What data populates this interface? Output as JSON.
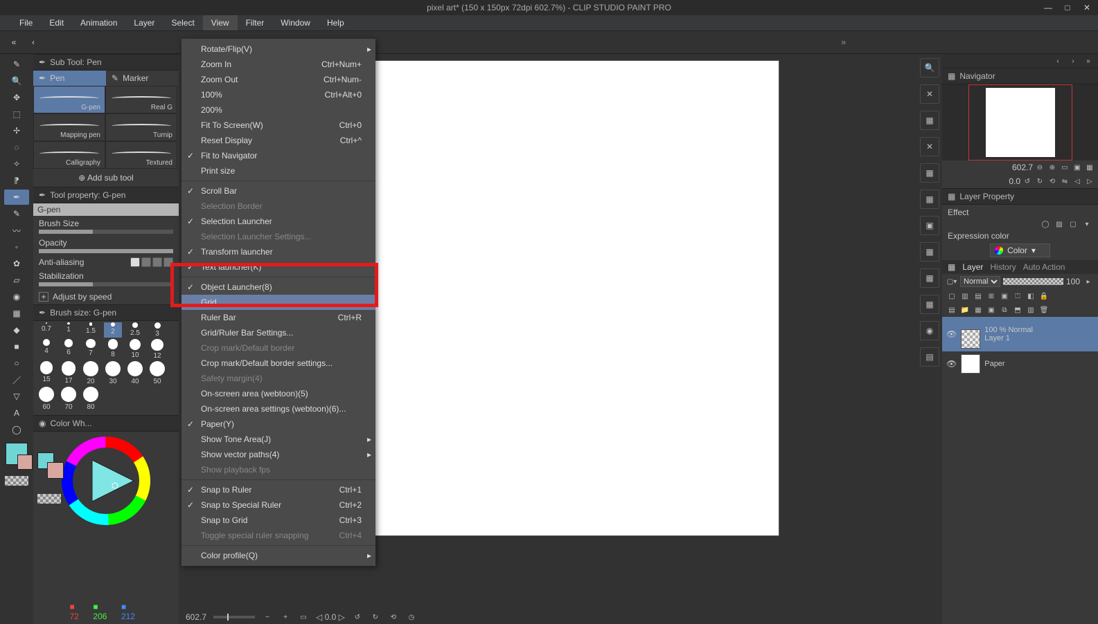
{
  "title": "pixel art* (150 x 150px 72dpi 602.7%)  -  CLIP STUDIO PAINT PRO",
  "menubar": [
    "File",
    "Edit",
    "Animation",
    "Layer",
    "Select",
    "View",
    "Filter",
    "Window",
    "Help"
  ],
  "active_menu_index": 5,
  "view_menu": [
    {
      "label": "Rotate/Flip(V)",
      "sub": true
    },
    {
      "label": "Zoom In",
      "shortcut": "Ctrl+Num+"
    },
    {
      "label": "Zoom Out",
      "shortcut": "Ctrl+Num-"
    },
    {
      "label": "100%",
      "shortcut": "Ctrl+Alt+0"
    },
    {
      "label": "200%"
    },
    {
      "label": "Fit To Screen(W)",
      "shortcut": "Ctrl+0"
    },
    {
      "label": "Reset Display",
      "shortcut": "Ctrl+^"
    },
    {
      "label": "Fit to Navigator",
      "checked": true
    },
    {
      "label": "Print size"
    },
    {
      "sep": true
    },
    {
      "label": "Scroll Bar",
      "checked": true
    },
    {
      "label": "Selection Border",
      "disabled": true
    },
    {
      "label": "Selection Launcher",
      "checked": true
    },
    {
      "label": "Selection Launcher Settings...",
      "disabled": true
    },
    {
      "label": "Transform launcher",
      "checked": true
    },
    {
      "label": "Text launcher(K)",
      "checked": true
    },
    {
      "sep": true
    },
    {
      "label": "Object Launcher(8)",
      "checked": true,
      "hidden_behind": true
    },
    {
      "label": "Grid",
      "highlighted": true
    },
    {
      "label": "Ruler Bar",
      "shortcut": "Ctrl+R"
    },
    {
      "label": "Grid/Ruler Bar Settings..."
    },
    {
      "label": "Crop mark/Default border",
      "disabled": true
    },
    {
      "label": "Crop mark/Default border settings..."
    },
    {
      "label": "Safety margin(4)",
      "disabled": true
    },
    {
      "label": "On-screen area (webtoon)(5)"
    },
    {
      "label": "On-screen area settings (webtoon)(6)..."
    },
    {
      "label": "Paper(Y)",
      "checked": true
    },
    {
      "label": "Show Tone Area(J)",
      "sub": true
    },
    {
      "label": "Show vector paths(4)",
      "sub": true
    },
    {
      "label": "Show playback fps",
      "disabled": true
    },
    {
      "sep": true
    },
    {
      "label": "Snap to Ruler",
      "checked": true,
      "shortcut": "Ctrl+1"
    },
    {
      "label": "Snap to Special Ruler",
      "checked": true,
      "shortcut": "Ctrl+2"
    },
    {
      "label": "Snap to Grid",
      "shortcut": "Ctrl+3"
    },
    {
      "label": "Toggle special ruler snapping",
      "shortcut": "Ctrl+4",
      "disabled": true
    },
    {
      "sep": true
    },
    {
      "label": "Color profile(Q)",
      "sub": true
    }
  ],
  "subtool": {
    "header": "Sub Tool: Pen",
    "tabs": [
      "Pen",
      "Marker"
    ],
    "items": [
      "G-pen",
      "Real G",
      "Mapping pen",
      "Turnip",
      "Calligraphy",
      "Textured"
    ],
    "selected": 0,
    "add": "Add sub tool"
  },
  "toolprop": {
    "header": "Tool property: G-pen",
    "name": "G-pen",
    "rows": [
      "Brush Size",
      "Opacity",
      "Anti-aliasing",
      "Stabilization"
    ],
    "adjust": "Adjust by speed"
  },
  "brushsize": {
    "header": "Brush size: G-pen",
    "sizes": [
      "0.7",
      "1",
      "1.5",
      "2",
      "2.5",
      "3",
      "4",
      "6",
      "7",
      "8",
      "10",
      "12",
      "15",
      "17",
      "20",
      "30",
      "40",
      "50",
      "60",
      "70",
      "80"
    ],
    "selected": 3
  },
  "colorwheel": {
    "header": "Color Wh...",
    "r": "72",
    "g": "206",
    "b": "212"
  },
  "navigator": {
    "header": "Navigator",
    "zoom": "602.7",
    "angle": "0.0"
  },
  "layerprop": {
    "header": "Layer Property",
    "effect": "Effect",
    "expr_label": "Expression color",
    "expr_value": "Color"
  },
  "layer": {
    "tabs": [
      "Layer",
      "History",
      "Auto Action"
    ],
    "blend": "Normal",
    "opacity": "100",
    "layers": [
      {
        "name": "100 % Normal",
        "sub": "Layer 1",
        "sel": true,
        "checker": true
      },
      {
        "name": "Paper",
        "checker": false
      }
    ]
  },
  "status": {
    "zoom": "602.7",
    "angle": "0.0"
  }
}
